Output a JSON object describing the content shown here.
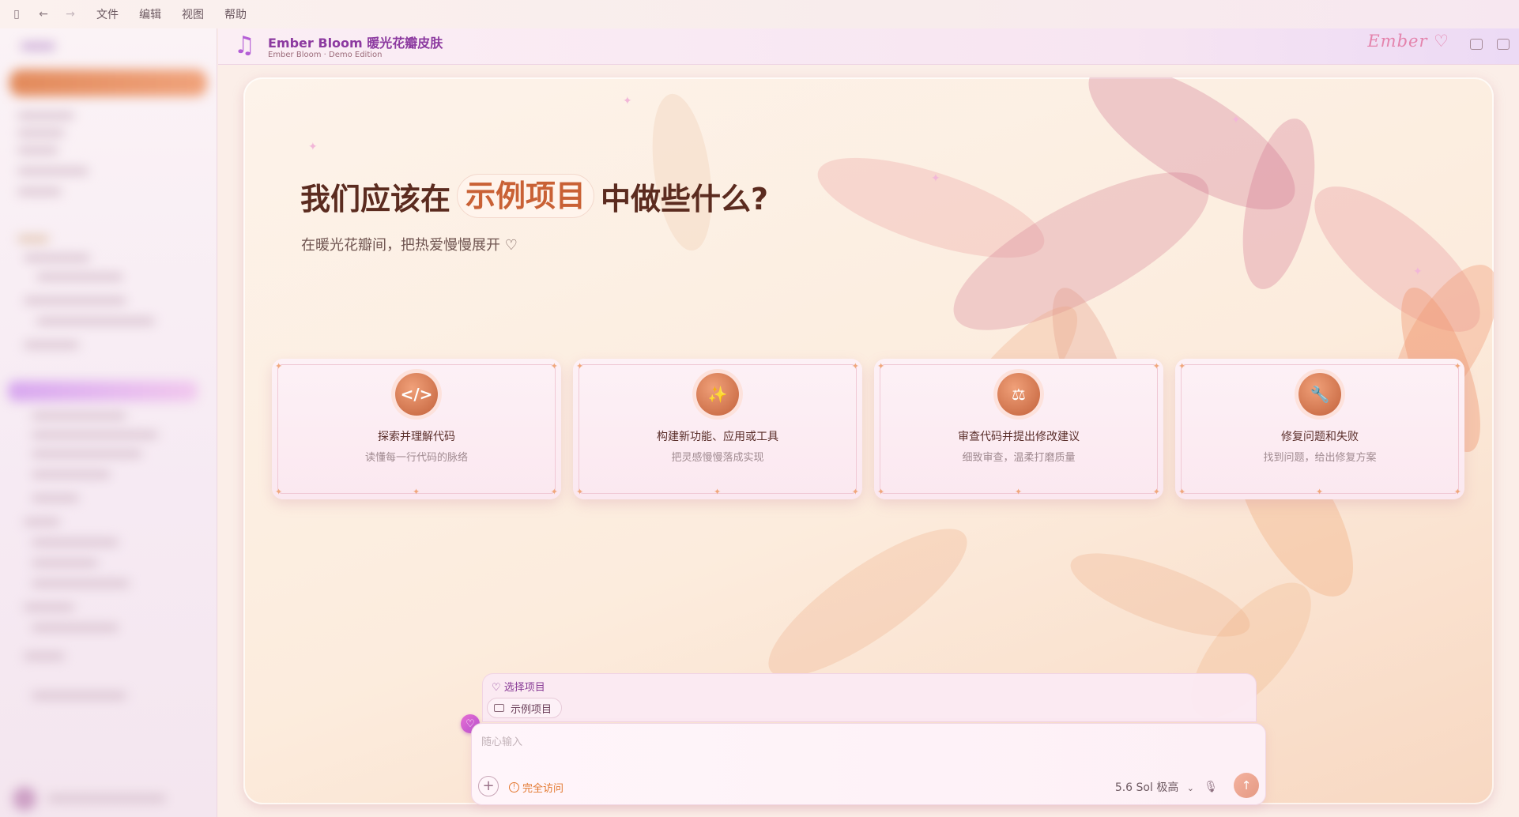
{
  "menu": {
    "items": [
      "文件",
      "编辑",
      "视图",
      "帮助"
    ]
  },
  "header": {
    "title": "Ember Bloom 暖光花瓣皮肤",
    "subtitle": "Ember Bloom · Demo Edition",
    "logo_text": "Ember ♡"
  },
  "hero": {
    "title_prefix": "我们应该在",
    "project": "示例项目",
    "title_suffix": "中做些什么?",
    "subtitle": "在暖光花瓣间，把热爱慢慢展开 ♡"
  },
  "cards": [
    {
      "icon": "code-icon",
      "title": "探索并理解代码",
      "desc": "读懂每一行代码的脉络"
    },
    {
      "icon": "magic-wand-icon",
      "title": "构建新功能、应用或工具",
      "desc": "把灵感慢慢落成实现"
    },
    {
      "icon": "scale-icon",
      "title": "审查代码并提出修改建议",
      "desc": "细致审查，温柔打磨质量"
    },
    {
      "icon": "wrench-icon",
      "title": "修复问题和失败",
      "desc": "找到问题，给出修复方案"
    }
  ],
  "project_panel": {
    "label": "♡ 选择项目",
    "chip": "示例项目"
  },
  "composer": {
    "placeholder": "随心输入",
    "access": "完全访问",
    "model": "5.6 Sol 极高"
  },
  "colors": {
    "accent": "#c96135",
    "brand": "#8c3aa0",
    "warning": "#e3782f"
  }
}
